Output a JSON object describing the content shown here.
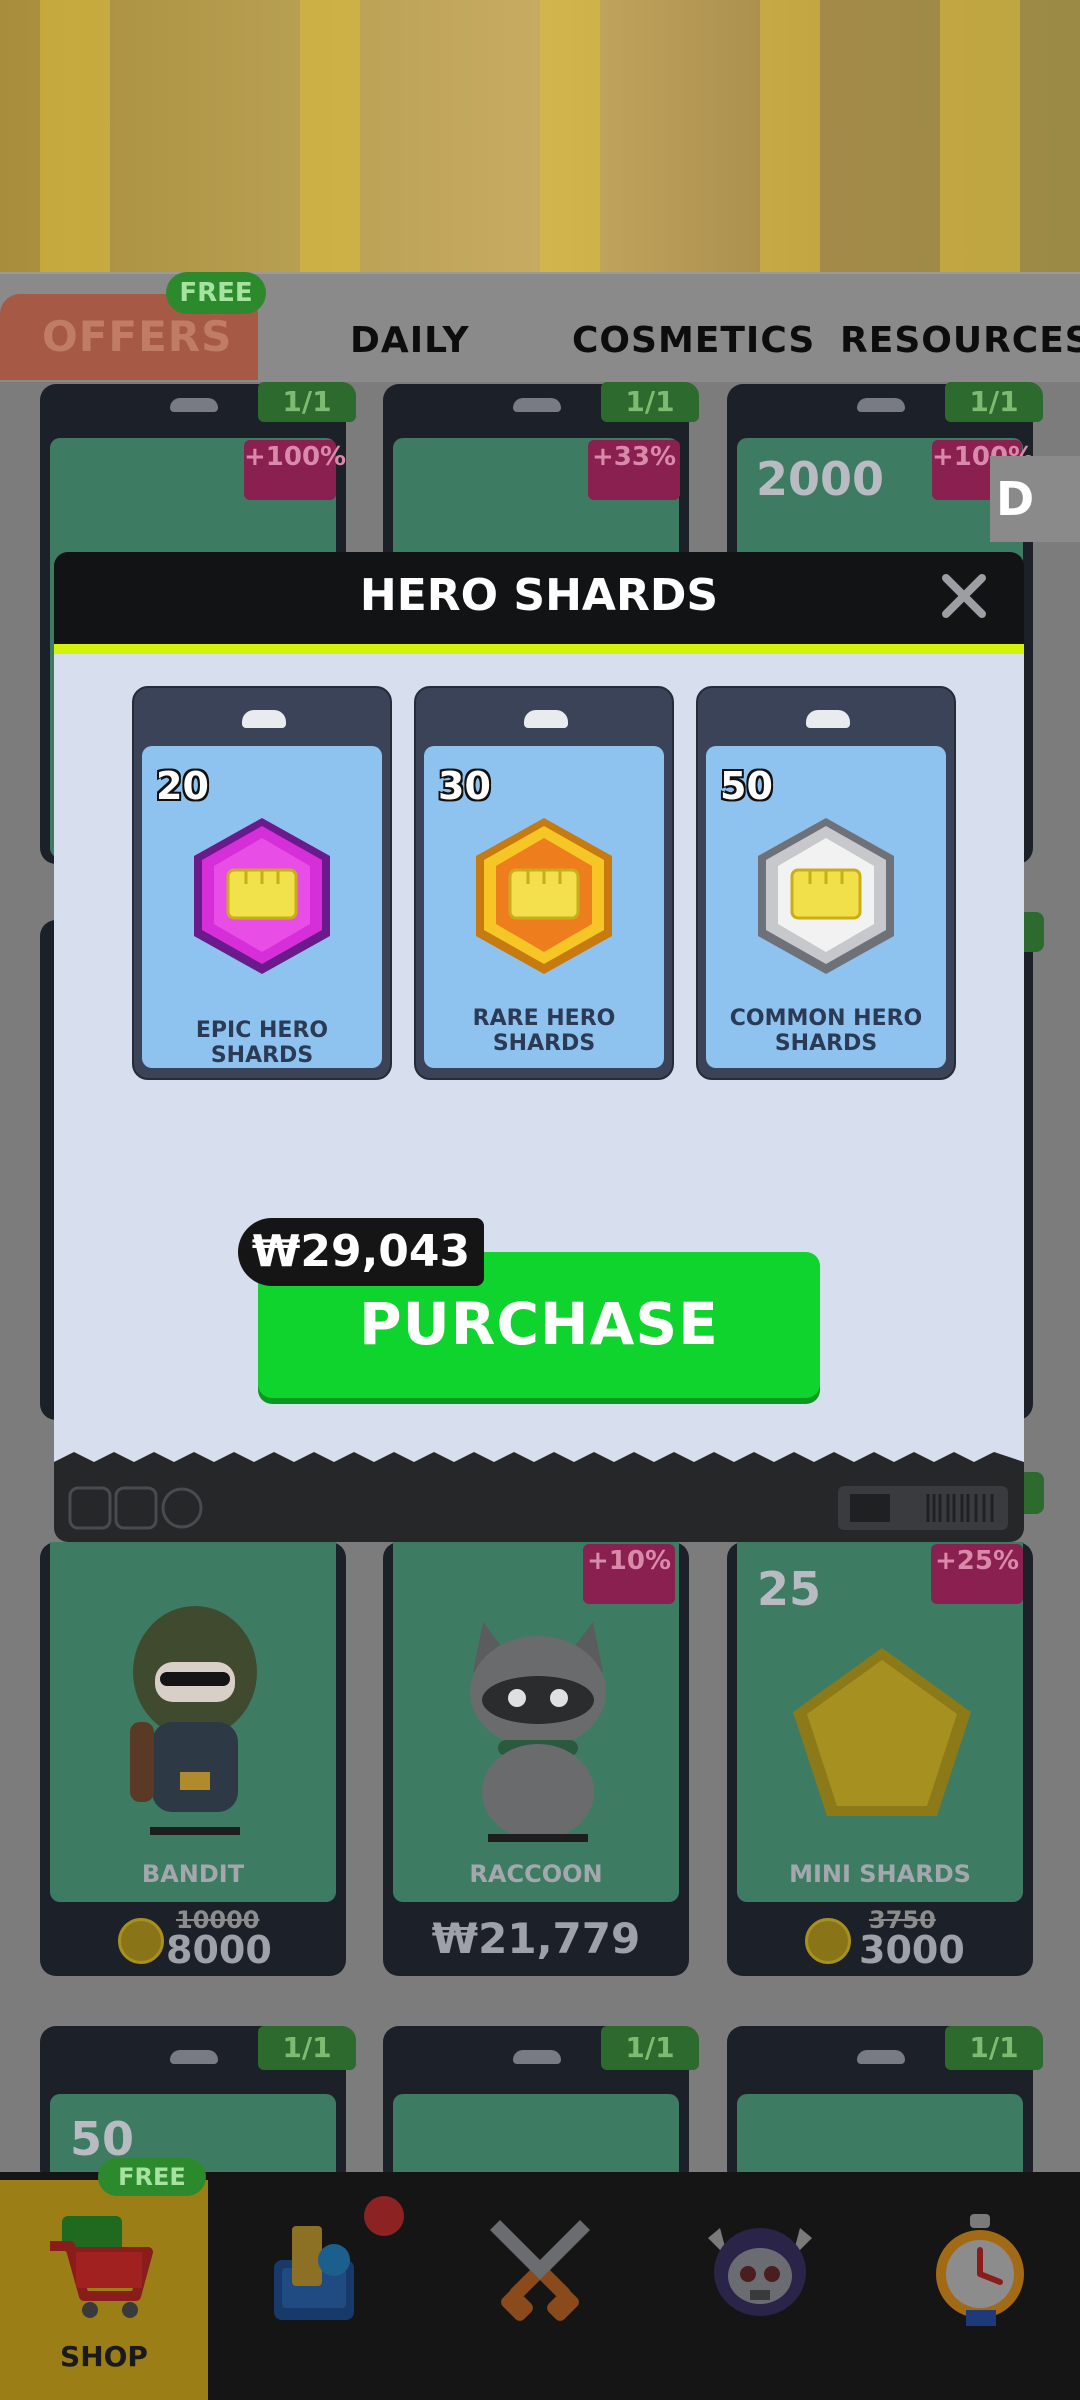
{
  "tabs": {
    "items": [
      {
        "label": "OFFERS"
      },
      {
        "label": "DAILY"
      },
      {
        "label": "COSMETICS"
      },
      {
        "label": "RESOURCES"
      }
    ],
    "free_badge": "FREE"
  },
  "grid_top": {
    "count_labels": [
      "1/1",
      "1/1",
      "1/1"
    ],
    "badges": [
      "+100%",
      "+33%",
      "+100%"
    ],
    "amount": "2000",
    "side_letter": "D"
  },
  "modal": {
    "title": "HERO SHARDS",
    "close_icon": "close-icon",
    "items": [
      {
        "count": "20",
        "name": "EPIC HERO SHARDS",
        "color": "#c02fc4"
      },
      {
        "count": "30",
        "name": "RARE HERO SHARDS",
        "color": "#f4b51a"
      },
      {
        "count": "50",
        "name": "COMMON HERO SHARDS",
        "color": "#c9c9c9"
      }
    ],
    "price": "₩29,043",
    "purchase_label": "PURCHASE",
    "accent_color": "#d4f20a",
    "button_color": "#0fd42d"
  },
  "grid_mid": {
    "items": [
      {
        "name": "BANDIT",
        "old_price": "10000",
        "price": "8000"
      },
      {
        "name": "RACCOON",
        "badge": "+10%",
        "price": "₩21,779"
      },
      {
        "name": "MINI SHARDS",
        "count": "25",
        "badge": "+25%",
        "old_price": "3750",
        "price": "3000"
      }
    ]
  },
  "grid_bottom": {
    "count_labels": [
      "1/1",
      "1/1",
      "1/1"
    ],
    "amount": "50"
  },
  "nav": {
    "free_badge": "FREE",
    "shop_label": "SHOP",
    "icons": [
      "shopping-cart-icon",
      "chess-piece-icon",
      "crossed-swords-icon",
      "skull-helmet-icon",
      "stopwatch-icon"
    ]
  }
}
